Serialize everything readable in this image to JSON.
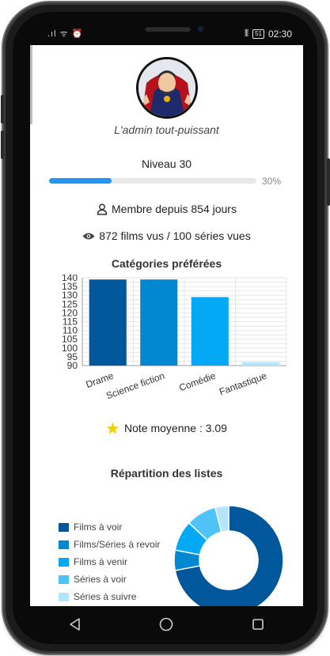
{
  "status_bar": {
    "left_icons": ".ıl ᯤ ⏰",
    "right_signal": "⫴",
    "battery": "51",
    "time": "02:30"
  },
  "profile": {
    "username": "L'admin tout-puissant",
    "level_label": "Niveau 30",
    "progress_percent_label": "30%",
    "progress_value": 0.3,
    "member_since": "Membre depuis 854 jours",
    "seen_stats": "872 films vus / 100 séries vues"
  },
  "favorites": {
    "title": "Catégories préférées"
  },
  "chart_data": [
    {
      "type": "bar",
      "title": "Catégories préférées",
      "categories": [
        "Drame",
        "Science fiction",
        "Comédie",
        "Fantastique"
      ],
      "values": [
        139,
        139,
        129,
        92
      ],
      "ylim": [
        90,
        140
      ],
      "yticks": [
        90,
        95,
        100,
        105,
        110,
        115,
        120,
        125,
        130,
        135,
        140
      ],
      "grid": true,
      "colors": [
        "#01579b",
        "#0288d1",
        "#03a9f4",
        "#b3e5fc"
      ]
    },
    {
      "type": "pie",
      "title": "Répartition des listes",
      "labels": [
        "Films à voir",
        "Films/Séries à revoir",
        "Films à venir",
        "Séries à voir",
        "Séries à suivre"
      ],
      "values": [
        72,
        6,
        9,
        9,
        4
      ],
      "colors": [
        "#01579b",
        "#0288d1",
        "#03a9f4",
        "#4fc3f7",
        "#b3e5fc"
      ],
      "legend": "left"
    }
  ],
  "rating": {
    "label": "Note moyenne : 3.09"
  },
  "lists": {
    "title": "Répartition des listes"
  },
  "icons": {
    "member": "person-outline-icon",
    "seen": "eye-icon",
    "rating": "star-icon",
    "back": "back-triangle-icon",
    "home": "home-circle-icon",
    "recents": "recents-square-icon"
  },
  "colors": {
    "progress": "#2196f3",
    "star": "#f5d000"
  }
}
